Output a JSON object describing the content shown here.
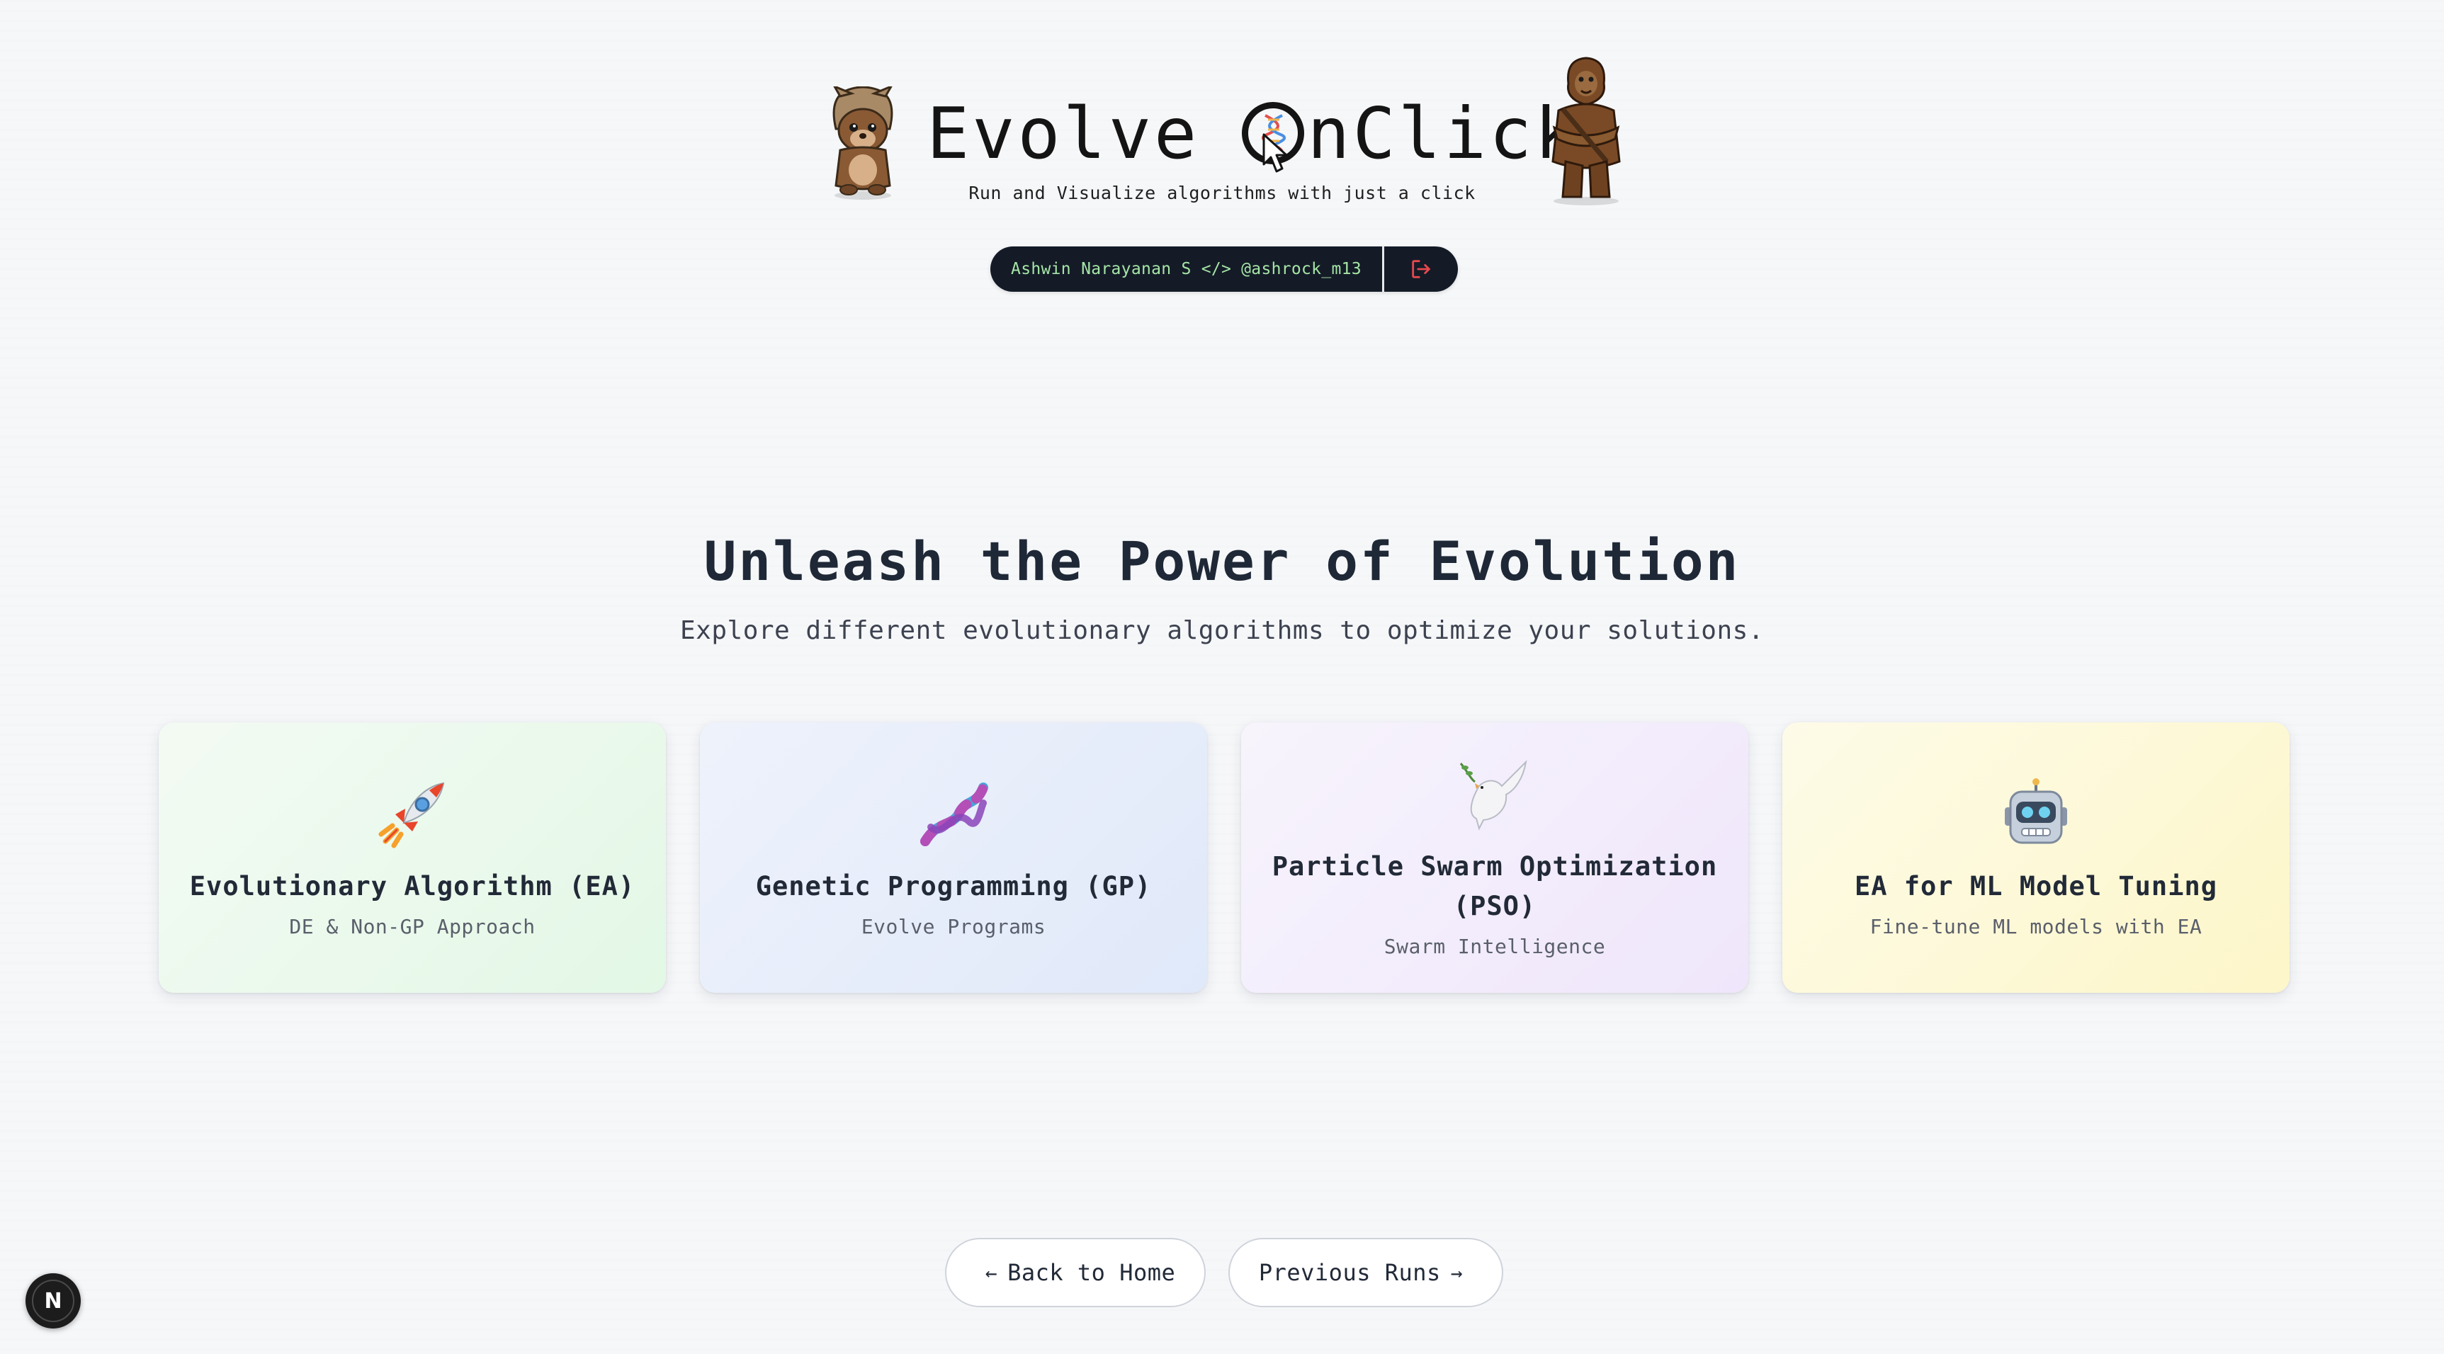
{
  "header": {
    "title_part1": "Evolve",
    "title_part2": "nClick",
    "tagline": "Run and Visualize algorithms with just a click",
    "author_name": "Ashwin Narayanan S",
    "code_tag": "</>",
    "author_handle": "@ashrock_m13",
    "logout_icon": "logout-icon",
    "logout_color": "#e5484d"
  },
  "section": {
    "title": "Unleash the Power of Evolution",
    "subtitle": "Explore different evolutionary algorithms to optimize your solutions."
  },
  "cards": [
    {
      "icon": "rocket-icon",
      "title": "Evolutionary Algorithm (EA)",
      "description": "DE & Non-GP Approach"
    },
    {
      "icon": "dna-icon",
      "title": "Genetic Programming (GP)",
      "description": "Evolve Programs"
    },
    {
      "icon": "dove-icon",
      "title": "Particle Swarm Optimization (PSO)",
      "description": "Swarm Intelligence"
    },
    {
      "icon": "robot-icon",
      "title": "EA for ML Model Tuning",
      "description": "Fine-tune ML models with EA"
    }
  ],
  "nav": {
    "back_label": "Back to Home",
    "back_arrow": "←",
    "previous_label": "Previous Runs",
    "previous_arrow": "→"
  },
  "badge": {
    "letter": "N"
  }
}
